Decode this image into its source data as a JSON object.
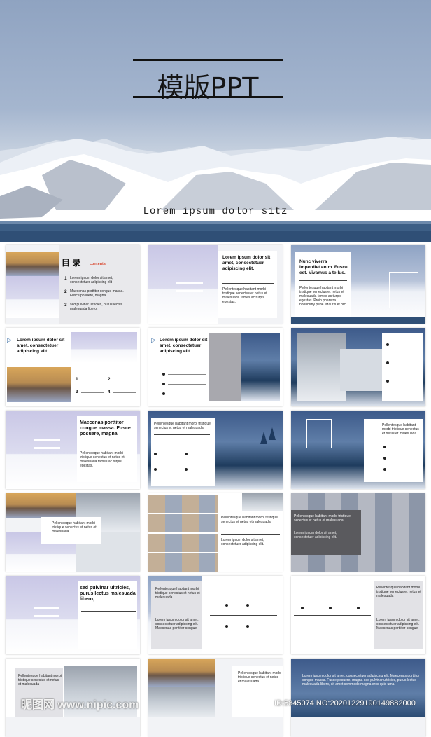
{
  "hero": {
    "title": "模版PPT",
    "subtitle": "Lorem ipsum dolor sitz"
  },
  "slides": {
    "s1_heading": "目 录",
    "s1_contents": "contents",
    "s1_items": [
      {
        "num": "1",
        "text": "Lorem ipsum dolor sit amet, consectetuer adipiscing elit"
      },
      {
        "num": "2",
        "text": "Maecenas porttitor congue massa. Fusce posuere, magna"
      },
      {
        "num": "3",
        "text": "sed pulvinar ultricies, purus lectus malesuada libero,"
      }
    ],
    "s2_title": "Lorem ipsum dolor sit amet, consectetuer adipiscing elit.",
    "s2_body": "Pellentesque habitant morbi tristique senectus et netus et malesuada fames ac turpis egestas.",
    "s3_title": "Nunc viverra imperdiet enim. Fusce est. Vivamus a tellus.",
    "s3_body": "Pellentesque habitant morbi tristique senectus et netus et malesuada fames ac turpis egestas. Proin pharetra nonummy pede. Mauris et orci.",
    "s4_title": "Lorem ipsum dolor sit amet, consectetuer adipiscing elit.",
    "s4_nums": [
      "1",
      "2",
      "3",
      "4"
    ],
    "s5_title": "Lorem ipsum dolor sit amet, consectetuer adipiscing elit.",
    "s7_title": "Maecenas porttitor congue massa. Fusce posuere, magna",
    "s7_body": "Pellentesque habitant morbi tristique senectus et netus et malesuada fames ac turpis egestas.",
    "s8_title": "Pellentesque habitant morbi tristique senectus et netus et malesuada",
    "s9_title": "Pellentesque habitant morbi tristique senectus et netus et malesuada",
    "s10_body": "Pellentesque habitant morbi tristique senectus et netus et malesuada",
    "s11_title": "Pellentesque habitant morbi tristique senectus et netus et malesuada",
    "s11_body": "Lorem ipsum dolor sit amet, consectetuer adipiscing elit.",
    "s12_title": "Pellentesque habitant morbi tristique senectus et netus et malesuada",
    "s12_body": "Lorem ipsum dolor sit amet, consectetuer adipiscing elit.",
    "s13_title": "sed pulvinar ultricies, purus lectus malesuada libero,",
    "s14_title": "Pellentesque habitant morbi tristique senectus et netus et malesuada",
    "s14_body": "Lorem ipsum dolor sit amet, consectetuer adipiscing elit. Maecenas porttitor congue",
    "s15_title": "Pellentesque habitant morbi tristique senectus et netus et malesuada",
    "s15_body": "Lorem ipsum dolor sit amet, consectetuer adipiscing elit. Maecenas porttitor congue",
    "s16_title": "Pellentesque habitant morbi tristique senectus et netus et malesuada",
    "s17_title": "Pellentesque habitant morbi tristique senectus et netus et malesuada",
    "s18_body": "Lorem ipsum dolor sit amet, consectetuer adipiscing elit. Maecenas porttitor congue massa. Fusce posuere, magna sed pulvinar ultricies, purus lectus malesuada libero, sit amet commodo magna eros quis urna."
  },
  "watermark": {
    "site": "昵图网 www.nipic.com",
    "id": "ID:5845074 NO:20201229190149882000"
  },
  "colors": {
    "hero_sky": "#a5b6cf",
    "title_bar": "#111111",
    "accent_red": "#d8452c",
    "accent_blue": "#3a6ea5"
  }
}
